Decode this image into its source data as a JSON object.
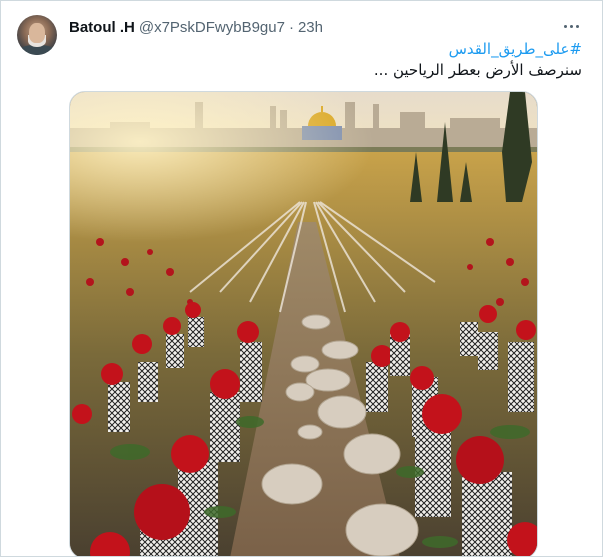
{
  "tweet": {
    "author": {
      "display_name": "Batoul .H",
      "handle": "@x7PskDFwybB9gu7",
      "avatar_icon": "user-avatar"
    },
    "separator": "·",
    "time": "23h",
    "more_icon": "more-horizontal-icon",
    "hashtag": "#على_طريق_القدس",
    "text": "سنرصف الأرض بعطر الرياحين ...",
    "media": {
      "type": "image",
      "subject": "rows of red roses wrapped in keffiyeh scarves along a stone path leading to the Dome of the Rock"
    }
  },
  "colors": {
    "link": "#1d9bf0",
    "text": "#0f1419",
    "secondary": "#536471",
    "border": "#cfd9de"
  }
}
